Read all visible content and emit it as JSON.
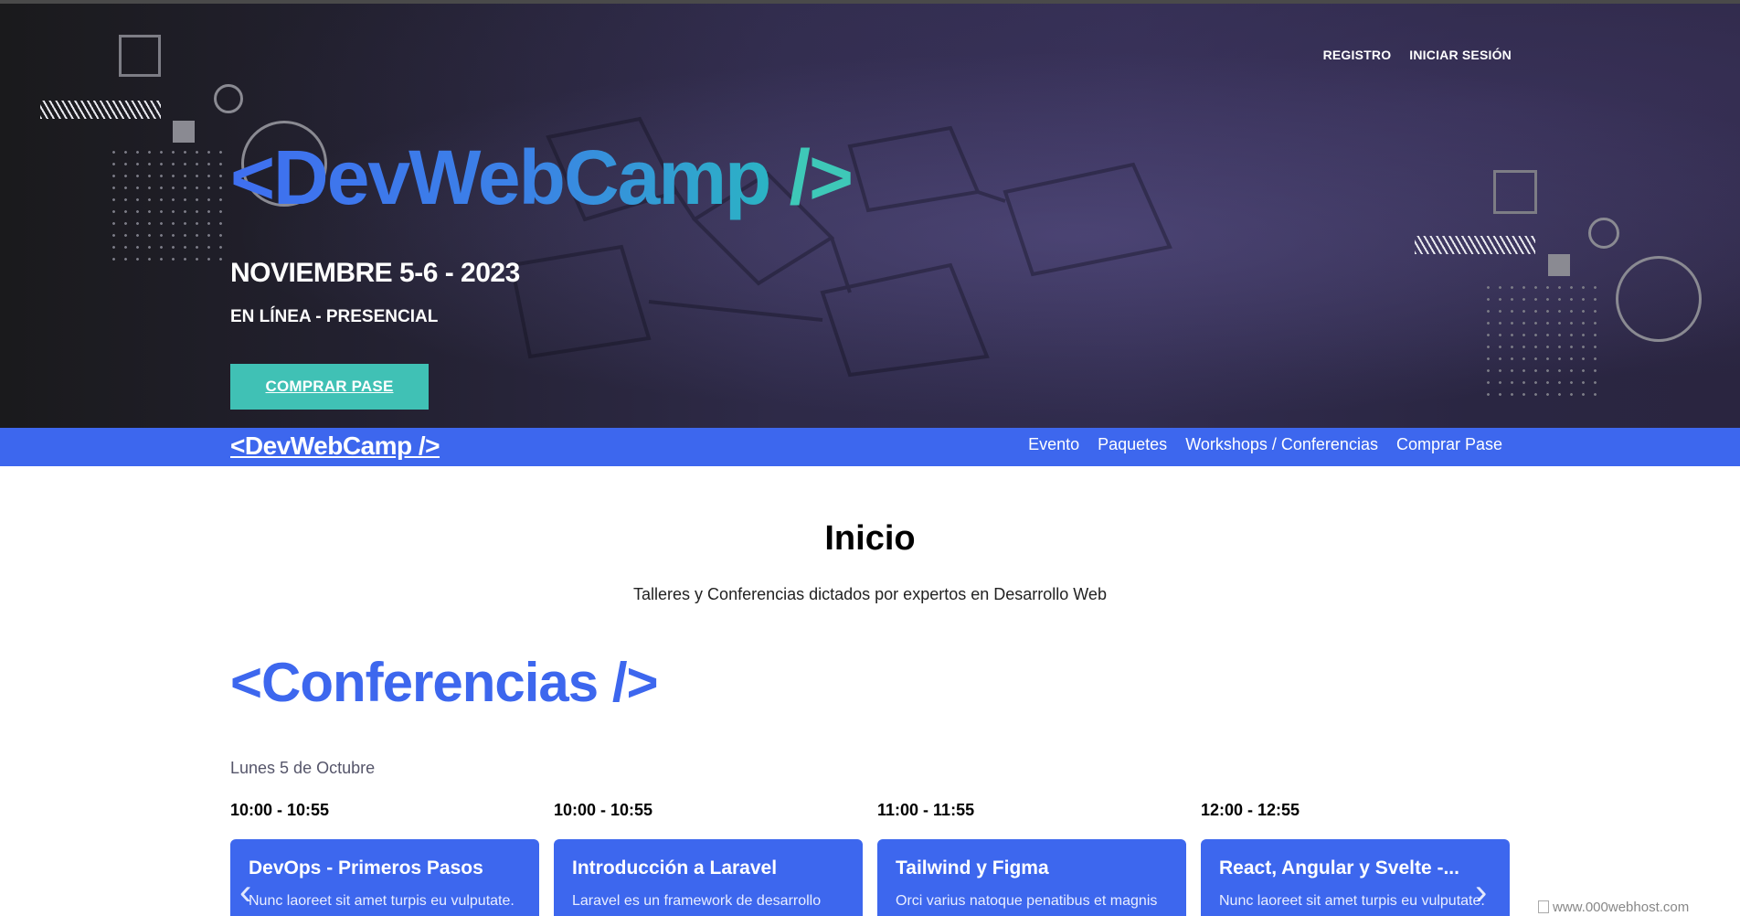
{
  "hero": {
    "auth": {
      "register": "REGISTRO",
      "login": "INICIAR SESIÓN"
    },
    "logo": {
      "main": "<DevWebCamp",
      "slash": "/>"
    },
    "date": "NOVIEMBRE 5-6 - 2023",
    "place": "EN LÍNEA - PRESENCIAL",
    "cta": "COMPRAR PASE"
  },
  "navbar": {
    "logo": "<DevWebCamp />",
    "links": [
      "Evento",
      "Paquetes",
      "Workshops / Conferencias",
      "Comprar Pase"
    ]
  },
  "main": {
    "title": "Inicio",
    "subtitle": "Talleres y Conferencias dictados por expertos en Desarrollo Web",
    "section_title": "<Conferencias />",
    "day": "Lunes 5 de Octubre",
    "events": [
      {
        "time": "10:00 - 10:55",
        "name": "DevOps - Primeros Pasos",
        "desc": "Nunc laoreet sit amet turpis eu vulputate."
      },
      {
        "time": "10:00 - 10:55",
        "name": "Introducción a Laravel",
        "desc": "Laravel es un framework de desarrollo"
      },
      {
        "time": "11:00 - 11:55",
        "name": "Tailwind y Figma",
        "desc": "Orci varius natoque penatibus et magnis"
      },
      {
        "time": "12:00 - 12:55",
        "name": "React, Angular y Svelte -...",
        "desc": "Nunc laoreet sit amet turpis eu vulputate."
      }
    ]
  },
  "footer_badge": "www.000webhost.com",
  "colors": {
    "primary": "#3d67ee",
    "secondary": "#40c1b5"
  },
  "icons": {
    "prev": "chevron-left-icon",
    "next": "chevron-right-icon"
  }
}
